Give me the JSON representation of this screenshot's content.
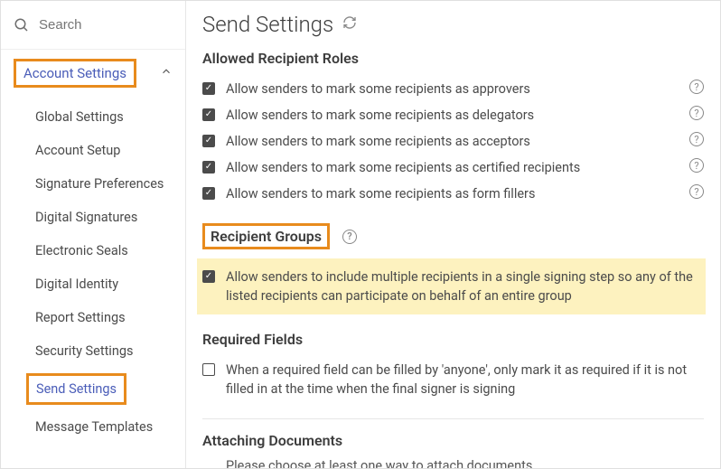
{
  "search": {
    "placeholder": "Search"
  },
  "sidebar": {
    "section_title": "Account Settings",
    "items": [
      {
        "label": "Global Settings"
      },
      {
        "label": "Account Setup"
      },
      {
        "label": "Signature Preferences"
      },
      {
        "label": "Digital Signatures"
      },
      {
        "label": "Electronic Seals"
      },
      {
        "label": "Digital Identity"
      },
      {
        "label": "Report Settings"
      },
      {
        "label": "Security Settings"
      },
      {
        "label": "Send Settings"
      },
      {
        "label": "Message Templates"
      }
    ]
  },
  "main": {
    "title": "Send Settings",
    "allowed_roles": {
      "heading": "Allowed Recipient Roles",
      "items": [
        {
          "label": "Allow senders to mark some recipients as approvers",
          "checked": true,
          "help": true
        },
        {
          "label": "Allow senders to mark some recipients as delegators",
          "checked": true,
          "help": true
        },
        {
          "label": "Allow senders to mark some recipients as acceptors",
          "checked": true,
          "help": true
        },
        {
          "label": "Allow senders to mark some recipients as certified recipients",
          "checked": true,
          "help": true
        },
        {
          "label": "Allow senders to mark some recipients as form fillers",
          "checked": true,
          "help": true
        }
      ]
    },
    "recipient_groups": {
      "heading": "Recipient Groups",
      "item": {
        "label": "Allow senders to include multiple recipients in a single signing step so any of the listed recipients can participate on behalf of an entire group",
        "checked": true
      }
    },
    "required_fields": {
      "heading": "Required Fields",
      "item": {
        "label": "When a required field can be filled by 'anyone', only mark it as required if it is not filled in at the time when the final signer is signing",
        "checked": false
      }
    },
    "attaching_documents": {
      "heading": "Attaching Documents",
      "description": "Please choose at least one way to attach documents"
    }
  }
}
